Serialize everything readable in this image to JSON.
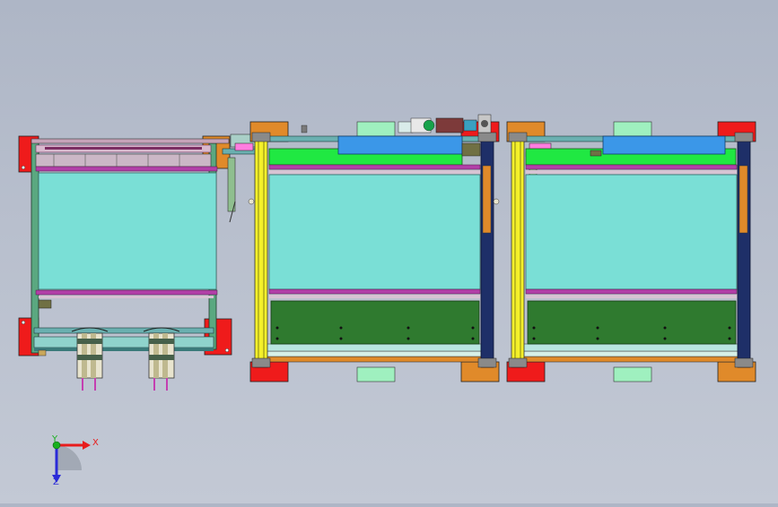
{
  "triad": {
    "x_label": "X",
    "y_label": "Y",
    "z_label": "Z"
  },
  "colors": {
    "background_top": "#aeb6c6",
    "background_bottom": "#c3c9d5",
    "conveyor_belt": "#7adfd6",
    "roller_bar": "#b23fa8",
    "blue_plate": "#3b97e8",
    "green_block": "#20e842",
    "dark_green_panel": "#2f7a2f",
    "yellow_post": "#f4f02a",
    "navy_post": "#1e2f68",
    "orange_plate": "#e08a2a",
    "red_plate": "#ef1b1b",
    "mint_tab": "#9ff0bf",
    "axis_x": "#e81c1c",
    "axis_y": "#18b01e",
    "axis_z": "#2a2ad8"
  }
}
